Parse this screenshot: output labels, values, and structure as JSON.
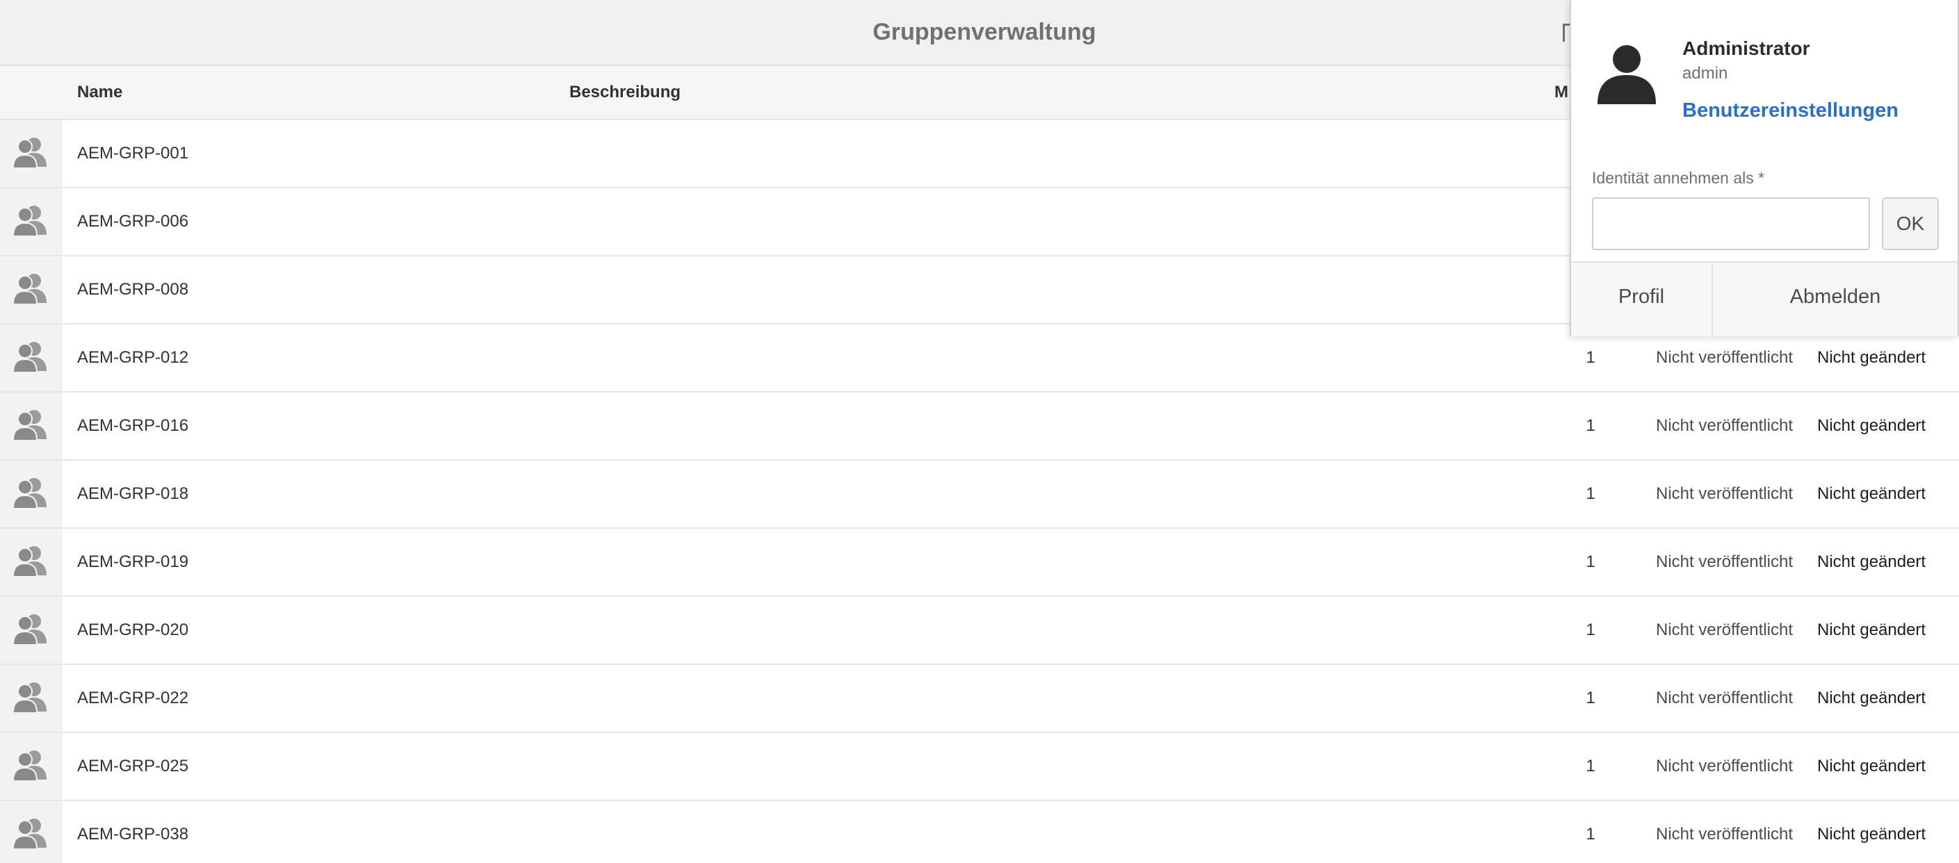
{
  "header": {
    "title": "Gruppenverwaltung"
  },
  "columns": {
    "name": "Name",
    "description": "Beschreibung",
    "members_partial": "M"
  },
  "groups": [
    {
      "name": "AEM-GRP-001"
    },
    {
      "name": "AEM-GRP-006"
    },
    {
      "name": "AEM-GRP-008"
    },
    {
      "name": "AEM-GRP-012",
      "members": "1",
      "published": "Nicht veröffentlicht",
      "modified": "Nicht geändert"
    },
    {
      "name": "AEM-GRP-016",
      "members": "1",
      "published": "Nicht veröffentlicht",
      "modified": "Nicht geändert"
    },
    {
      "name": "AEM-GRP-018",
      "members": "1",
      "published": "Nicht veröffentlicht",
      "modified": "Nicht geändert"
    },
    {
      "name": "AEM-GRP-019",
      "members": "1",
      "published": "Nicht veröffentlicht",
      "modified": "Nicht geändert"
    },
    {
      "name": "AEM-GRP-020",
      "members": "1",
      "published": "Nicht veröffentlicht",
      "modified": "Nicht geändert"
    },
    {
      "name": "AEM-GRP-022",
      "members": "1",
      "published": "Nicht veröffentlicht",
      "modified": "Nicht geändert"
    },
    {
      "name": "AEM-GRP-025",
      "members": "1",
      "published": "Nicht veröffentlicht",
      "modified": "Nicht geändert"
    },
    {
      "name": "AEM-GRP-038",
      "members": "1",
      "published": "Nicht veröffentlicht",
      "modified": "Nicht geändert"
    }
  ],
  "user_popover": {
    "display_name": "Administrator",
    "user_id": "admin",
    "settings_link": "Benutzereinstellungen",
    "impersonate_label": "Identität annehmen als *",
    "impersonate_value": "",
    "ok_label": "OK",
    "profile_label": "Profil",
    "logout_label": "Abmelden"
  },
  "colors": {
    "link": "#2d6ec6",
    "header_bg": "#f0f0f0",
    "icon_gray": "#8a8a8a"
  },
  "icons": {
    "group_row": "group-icon",
    "avatar": "user-avatar-icon"
  }
}
